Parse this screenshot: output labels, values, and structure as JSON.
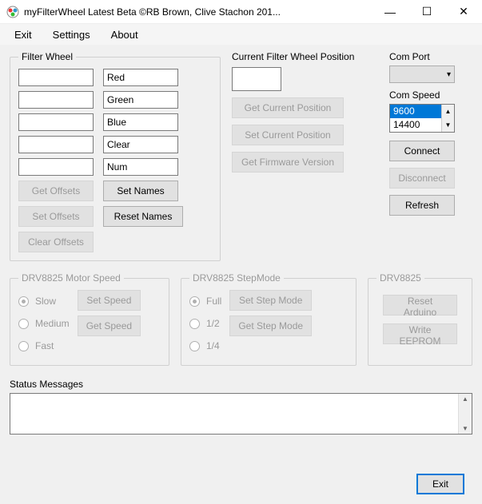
{
  "window": {
    "title": "myFilterWheel Latest Beta ©RB Brown, Clive Stachon 201...",
    "buttons": {
      "min": "—",
      "max": "☐",
      "close": "✕"
    }
  },
  "menu": {
    "exit": "Exit",
    "settings": "Settings",
    "about": "About"
  },
  "filterWheel": {
    "legend": "Filter Wheel",
    "offsets": [
      "",
      "",
      "",
      "",
      ""
    ],
    "names": [
      "Red",
      "Green",
      "Blue",
      "Clear",
      "Num"
    ],
    "buttons": {
      "getOffsets": "Get Offsets",
      "setOffsets": "Set Offsets",
      "clearOffsets": "Clear Offsets",
      "setNames": "Set Names",
      "resetNames": "Reset Names"
    }
  },
  "cfw": {
    "label": "Current Filter Wheel Position",
    "value": "",
    "buttons": {
      "getPos": "Get Current Position",
      "setPos": "Set Current Position",
      "getFw": "Get Firmware Version"
    }
  },
  "comPort": {
    "label": "Com Port",
    "value": ""
  },
  "comSpeed": {
    "label": "Com Speed",
    "options": [
      "9600",
      "14400"
    ],
    "selected": "9600"
  },
  "conn": {
    "connect": "Connect",
    "disconnect": "Disconnect",
    "refresh": "Refresh"
  },
  "motorSpeed": {
    "legend": "DRV8825 Motor Speed",
    "options": {
      "slow": "Slow",
      "medium": "Medium",
      "fast": "Fast"
    },
    "buttons": {
      "set": "Set Speed",
      "get": "Get Speed"
    }
  },
  "stepMode": {
    "legend": "DRV8825 StepMode",
    "options": {
      "full": "Full",
      "half": "1/2",
      "quarter": "1/4"
    },
    "buttons": {
      "set": "Set Step Mode",
      "get": "Get Step Mode"
    }
  },
  "drv8825": {
    "legend": "DRV8825",
    "buttons": {
      "reset": "Reset Arduino",
      "eeprom": "Write EEPROM"
    }
  },
  "status": {
    "label": "Status Messages",
    "value": ""
  },
  "footer": {
    "exit": "Exit"
  }
}
